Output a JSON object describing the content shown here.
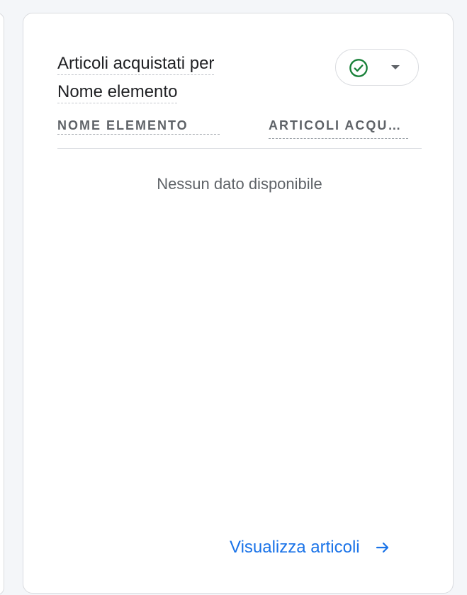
{
  "card": {
    "title_line1": "Articoli acquistati per",
    "title_line2": "Nome elemento",
    "status_icon": "check-circle-icon",
    "status_color": "#188038",
    "dropdown_icon": "chevron-down-icon"
  },
  "table": {
    "columns": [
      "NOME ELEMENTO",
      "ARTICOLI ACQU…"
    ],
    "empty_message": "Nessun dato disponibile"
  },
  "footer": {
    "link_label": "Visualizza articoli",
    "link_icon": "arrow-right-icon",
    "link_color": "#1a73e8"
  }
}
